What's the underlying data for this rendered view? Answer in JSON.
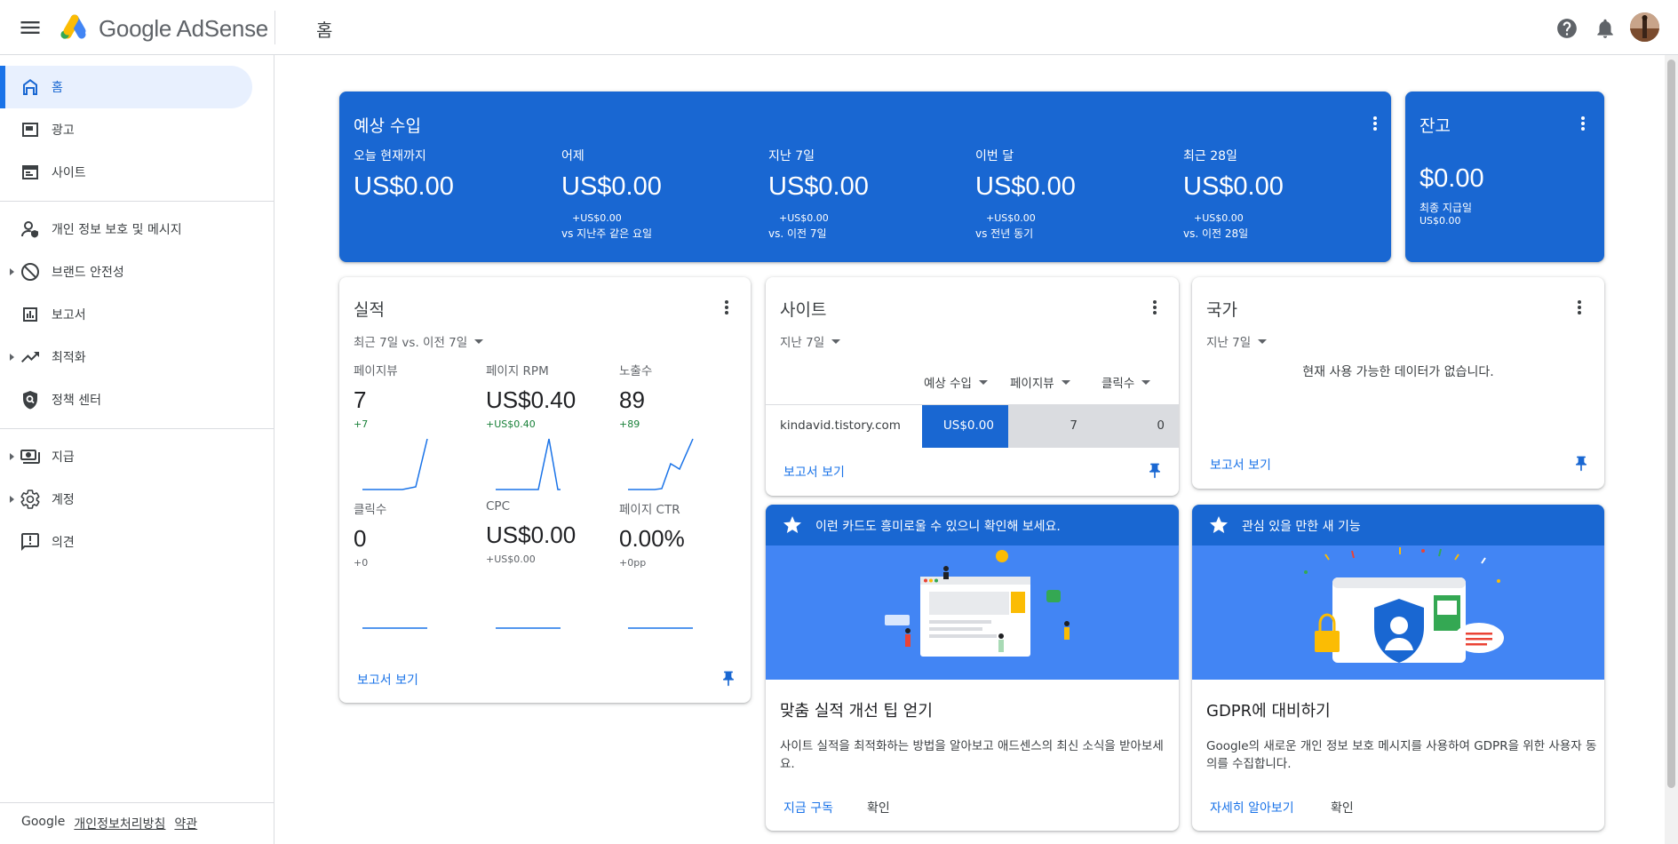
{
  "app": {
    "logo_text": "Google AdSense",
    "page_title": "홈"
  },
  "topbar": {
    "help_icon": "help-circle",
    "bell_icon": "notifications-bell",
    "avatar_icon": "user-avatar"
  },
  "sidebar": {
    "items": [
      {
        "label": "홈",
        "icon": "home",
        "active": true
      },
      {
        "label": "광고",
        "icon": "ads"
      },
      {
        "label": "사이트",
        "icon": "sites"
      },
      {
        "label": "개인 정보 보호 및 메시지",
        "icon": "privacy-person"
      },
      {
        "label": "브랜드 안전성",
        "icon": "block",
        "expandable": true
      },
      {
        "label": "보고서",
        "icon": "bar-chart"
      },
      {
        "label": "최적화",
        "icon": "trending-up",
        "expandable": true
      },
      {
        "label": "정책 센터",
        "icon": "policy-shield"
      },
      {
        "label": "지급",
        "icon": "payments",
        "expandable": true
      },
      {
        "label": "계정",
        "icon": "gear",
        "expandable": true
      },
      {
        "label": "의견",
        "icon": "feedback"
      }
    ],
    "footer": {
      "google": "Google",
      "privacy": "개인정보처리방침",
      "terms": "약관"
    }
  },
  "earnings": {
    "title": "예상 수입",
    "columns": [
      {
        "label": "오늘 현재까지",
        "value": "US$0.00",
        "sub1": "",
        "sub2": ""
      },
      {
        "label": "어제",
        "value": "US$0.00",
        "sub1": "+US$0.00",
        "sub2": "vs 지난주 같은 요일"
      },
      {
        "label": "지난 7일",
        "value": "US$0.00",
        "sub1": "+US$0.00",
        "sub2": "vs. 이전 7일"
      },
      {
        "label": "이번 달",
        "value": "US$0.00",
        "sub1": "+US$0.00",
        "sub2": "vs 전년 동기"
      },
      {
        "label": "최근 28일",
        "value": "US$0.00",
        "sub1": "+US$0.00",
        "sub2": "vs. 이전 28일"
      }
    ]
  },
  "balance": {
    "title": "잔고",
    "value": "$0.00",
    "last_payment_label": "최종 지급일",
    "last_payment_value": "US$0.00"
  },
  "performance": {
    "title": "실적",
    "range": "최근 7일 vs. 이전 7일",
    "metrics": [
      {
        "label": "페이지뷰",
        "value": "7",
        "delta": "+7"
      },
      {
        "label": "페이지 RPM",
        "value": "US$0.40",
        "delta": "+US$0.40"
      },
      {
        "label": "노출수",
        "value": "89",
        "delta": "+89"
      },
      {
        "label": "클릭수",
        "value": "0",
        "delta": "+0"
      },
      {
        "label": "CPC",
        "value": "US$0.00",
        "delta": "+US$0.00"
      },
      {
        "label": "페이지 CTR",
        "value": "0.00%",
        "delta": "+0pp"
      }
    ],
    "report_link": "보고서 보기"
  },
  "sites": {
    "title": "사이트",
    "range": "지난 7일",
    "headers": [
      "예상 수입",
      "페이지뷰",
      "클릭수"
    ],
    "rows": [
      {
        "site": "kindavid.tistory.com",
        "earnings": "US$0.00",
        "pageviews": "7",
        "clicks": "0"
      }
    ],
    "report_link": "보고서 보기"
  },
  "countries": {
    "title": "국가",
    "range": "지난 7일",
    "empty_message": "현재 사용 가능한 데이터가 없습니다.",
    "report_link": "보고서 보기"
  },
  "tip_card": {
    "banner": "이런 카드도 흥미로울 수 있으니 확인해 보세요.",
    "title": "맞춤 실적 개선 팁 얻기",
    "body": "사이트 실적을 최적화하는 방법을 알아보고 애드센스의 최신 소식을 받아보세요.",
    "primary_action": "지금 구독",
    "secondary_action": "확인"
  },
  "feature_card": {
    "banner": "관심 있을 만한 새 기능",
    "title": "GDPR에 대비하기",
    "body": "Google의 새로운 개인 정보 보호 메시지를 사용하여 GDPR을 위한 사용자 동의를 수집합니다.",
    "primary_action": "자세히 알아보기",
    "secondary_action": "확인"
  },
  "colors": {
    "brand_blue": "#1967d2",
    "link_blue": "#1a73e8",
    "illustration_blue": "#4285f4",
    "positive_green": "#188038"
  }
}
